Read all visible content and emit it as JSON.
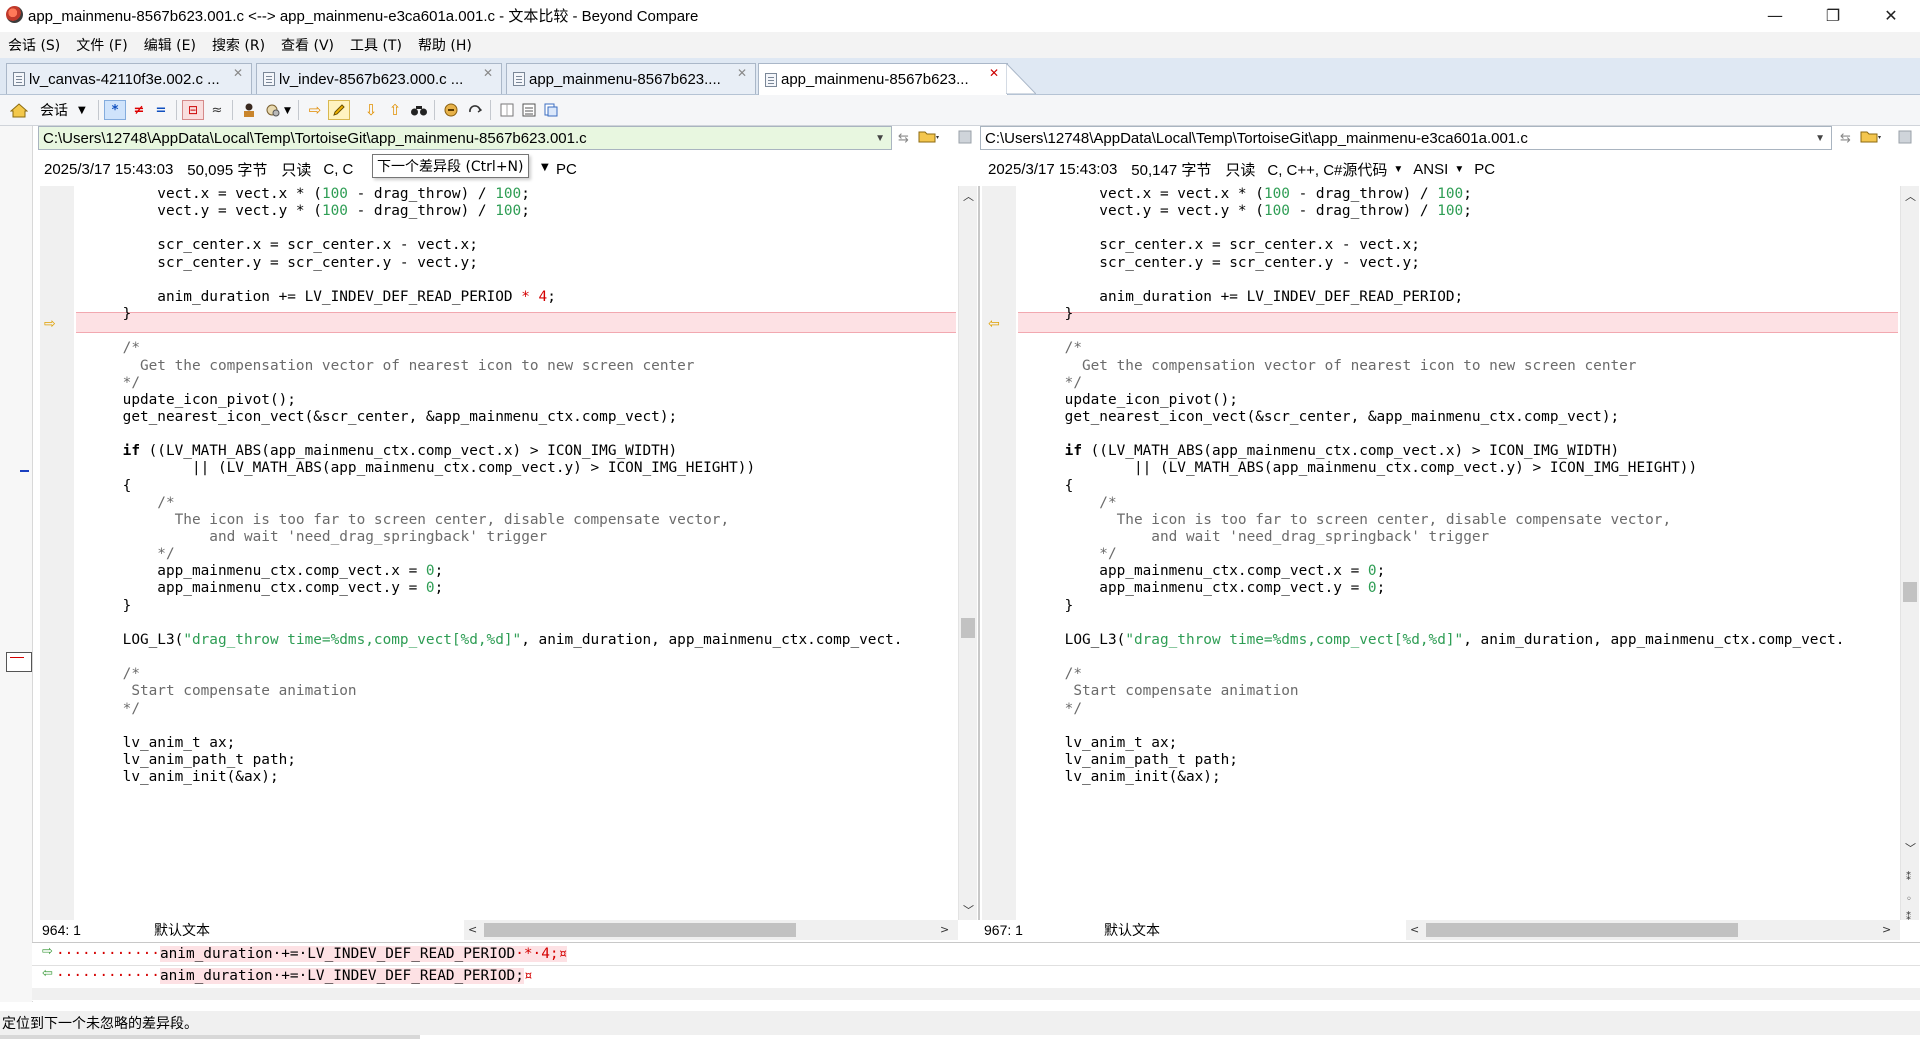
{
  "window": {
    "title": "app_mainmenu-8567b623.001.c <--> app_mainmenu-e3ca601a.001.c - 文本比较 - Beyond Compare",
    "minimize": "—",
    "restore": "❐",
    "close": "✕"
  },
  "menu": [
    "会话 (S)",
    "文件 (F)",
    "编辑 (E)",
    "搜索 (R)",
    "查看 (V)",
    "工具 (T)",
    "帮助 (H)"
  ],
  "tabs": [
    {
      "label": "lv_canvas-42110f3e.002.c ...",
      "close": "✕"
    },
    {
      "label": "lv_indev-8567b623.000.c ...",
      "close": "✕"
    },
    {
      "label": "app_mainmenu-8567b623....",
      "close": "✕"
    },
    {
      "label": "app_mainmenu-8567b623...",
      "close": "✕"
    }
  ],
  "toolbar": {
    "session_label": "会话",
    "icons": [
      "home-icon",
      "session-dropdown",
      "show-all-icon",
      "show-diffs-icon",
      "show-same-icon",
      "toggle-ignore-icon",
      "minor-icon",
      "rules-icon",
      "format-icon",
      "next-section-icon",
      "edit-icon",
      "next-diff-icon",
      "prev-diff-icon",
      "find-icon",
      "stop-icon",
      "refresh-icon",
      "panes-icon",
      "output-icon",
      "copy-icon"
    ]
  },
  "left_pane": {
    "path": "C:\\Users\\12748\\AppData\\Local\\Temp\\TortoiseGit\\app_mainmenu-8567b623.001.c",
    "date": "2025/3/17 15:43:03",
    "size": "50,095 字节",
    "readonly": "只读",
    "format_partial": "C, C",
    "lineend": "PC",
    "cursor": "964: 1",
    "encoding_label": "默认文本"
  },
  "right_pane": {
    "path": "C:\\Users\\12748\\AppData\\Local\\Temp\\TortoiseGit\\app_mainmenu-e3ca601a.001.c",
    "date": "2025/3/17 15:43:03",
    "size": "50,147 字节",
    "readonly": "只读",
    "format": "C, C++, C#源代码",
    "charset": "ANSI",
    "lineend": "PC",
    "cursor": "967: 1",
    "encoding_label": "默认文本"
  },
  "tooltip": "下一个差异段 (Ctrl+N)",
  "code_left": [
    "        vect.x = vect.x * (100 - drag_throw) / 100;",
    "        vect.y = vect.y * (100 - drag_throw) / 100;",
    "",
    "        scr_center.x = scr_center.x - vect.x;",
    "        scr_center.y = scr_center.y - vect.y;",
    "",
    "        anim_duration += LV_INDEV_DEF_READ_PERIOD * 4;",
    "    }",
    "",
    "    /*",
    "      Get the compensation vector of nearest icon to new screen center",
    "    */",
    "    update_icon_pivot();",
    "    get_nearest_icon_vect(&scr_center, &app_mainmenu_ctx.comp_vect);",
    "",
    "    if ((LV_MATH_ABS(app_mainmenu_ctx.comp_vect.x) > ICON_IMG_WIDTH)",
    "            || (LV_MATH_ABS(app_mainmenu_ctx.comp_vect.y) > ICON_IMG_HEIGHT))",
    "    {",
    "        /*",
    "          The icon is too far to screen center, disable compensate vector,",
    "              and wait 'need_drag_springback' trigger",
    "        */",
    "        app_mainmenu_ctx.comp_vect.x = 0;",
    "        app_mainmenu_ctx.comp_vect.y = 0;",
    "    }",
    "",
    "    LOG_L3(\"drag_throw time=%dms,comp_vect[%d,%d]\", anim_duration, app_mainmenu_ctx.comp_vect.",
    "",
    "    /*",
    "     Start compensate animation",
    "    */",
    "",
    "    lv_anim_t ax;",
    "    lv_anim_path_t path;",
    "    lv_anim_init(&ax);"
  ],
  "code_right": [
    "        vect.x = vect.x * (100 - drag_throw) / 100;",
    "        vect.y = vect.y * (100 - drag_throw) / 100;",
    "",
    "        scr_center.x = scr_center.x - vect.x;",
    "        scr_center.y = scr_center.y - vect.y;",
    "",
    "        anim_duration += LV_INDEV_DEF_READ_PERIOD;",
    "    }",
    "",
    "    /*",
    "      Get the compensation vector of nearest icon to new screen center",
    "    */",
    "    update_icon_pivot();",
    "    get_nearest_icon_vect(&scr_center, &app_mainmenu_ctx.comp_vect);",
    "",
    "    if ((LV_MATH_ABS(app_mainmenu_ctx.comp_vect.x) > ICON_IMG_WIDTH)",
    "            || (LV_MATH_ABS(app_mainmenu_ctx.comp_vect.y) > ICON_IMG_HEIGHT))",
    "    {",
    "        /*",
    "          The icon is too far to screen center, disable compensate vector,",
    "              and wait 'need_drag_springback' trigger",
    "        */",
    "        app_mainmenu_ctx.comp_vect.x = 0;",
    "        app_mainmenu_ctx.comp_vect.y = 0;",
    "    }",
    "",
    "    LOG_L3(\"drag_throw time=%dms,comp_vect[%d,%d]\", anim_duration, app_mainmenu_ctx.comp_vect.",
    "",
    "    /*",
    "     Start compensate animation",
    "    */",
    "",
    "    lv_anim_t ax;",
    "    lv_anim_path_t path;",
    "    lv_anim_init(&ax);"
  ],
  "compare": {
    "left_prefix": "············",
    "left_common": "anim_duration·+=·LV_INDEV_DEF_READ_PERIOD",
    "left_diff": "·*·4",
    "left_end": ";¤",
    "right_prefix": "············",
    "right_common": "anim_duration·+=·LV_INDEV_DEF_READ_PERIOD;",
    "right_end": "¤"
  },
  "statusbar": "定位到下一个未忽略的差异段。",
  "colors": {
    "diff_bg": "#fde1e4",
    "left_path_bg": "#e8f7e0",
    "number_green": "#2e9d54",
    "diff_red": "#d40000"
  }
}
